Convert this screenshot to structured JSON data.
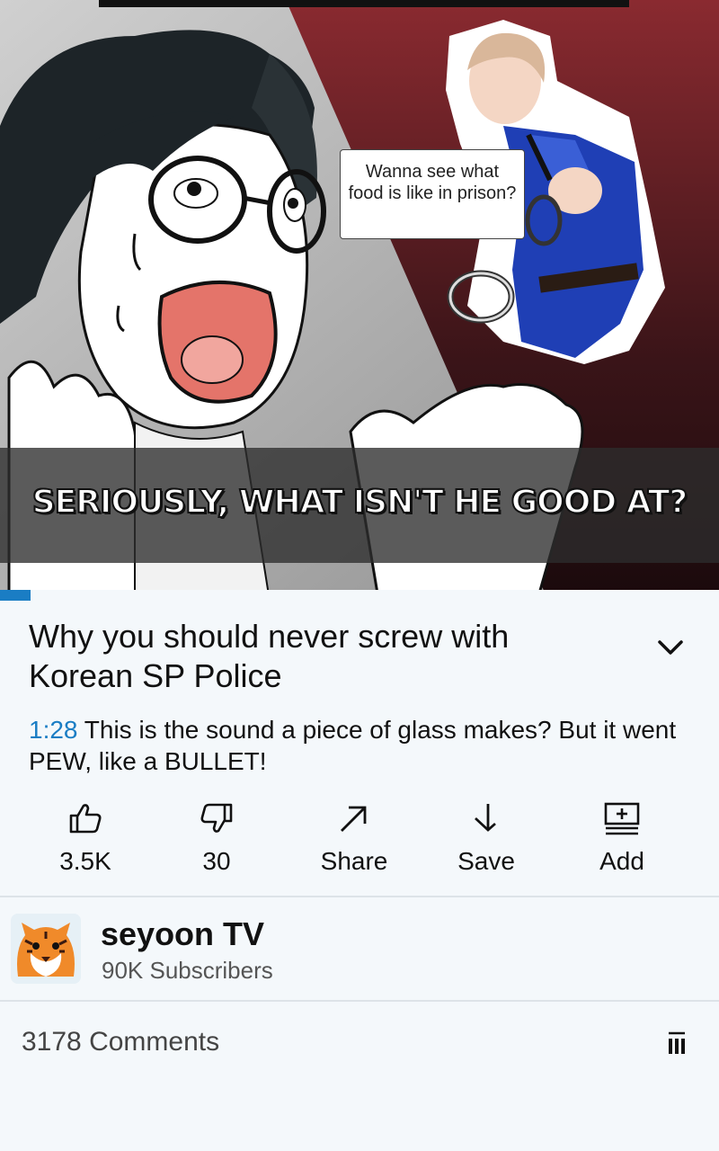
{
  "video": {
    "speech_bubble": "Wanna see what food is like in prison?",
    "caption": "SERIOUSLY, WHAT ISN'T HE GOOD AT?",
    "progress_fraction": 0.043
  },
  "title": "Why you should never screw with Korean SP Police",
  "description": {
    "timestamp": "1:28",
    "text": "This is the sound a piece of glass makes? But it went PEW, like a BULLET!"
  },
  "actions": [
    {
      "icon": "thumbs-up-icon",
      "label": "3.5K"
    },
    {
      "icon": "thumbs-down-icon",
      "label": "30"
    },
    {
      "icon": "share-icon",
      "label": "Share"
    },
    {
      "icon": "save-icon",
      "label": "Save"
    },
    {
      "icon": "add-to-playlist-icon",
      "label": "Add"
    }
  ],
  "channel": {
    "name": "seyoon TV",
    "subscribers": "90K Subscribers",
    "avatar": "tiger-avatar"
  },
  "comments": {
    "label": "3178 Comments",
    "sort_icon": "sort-icon"
  },
  "colors": {
    "accent": "#1a7dc4",
    "background": "#f4f8fb",
    "divider": "#dde3e8"
  }
}
